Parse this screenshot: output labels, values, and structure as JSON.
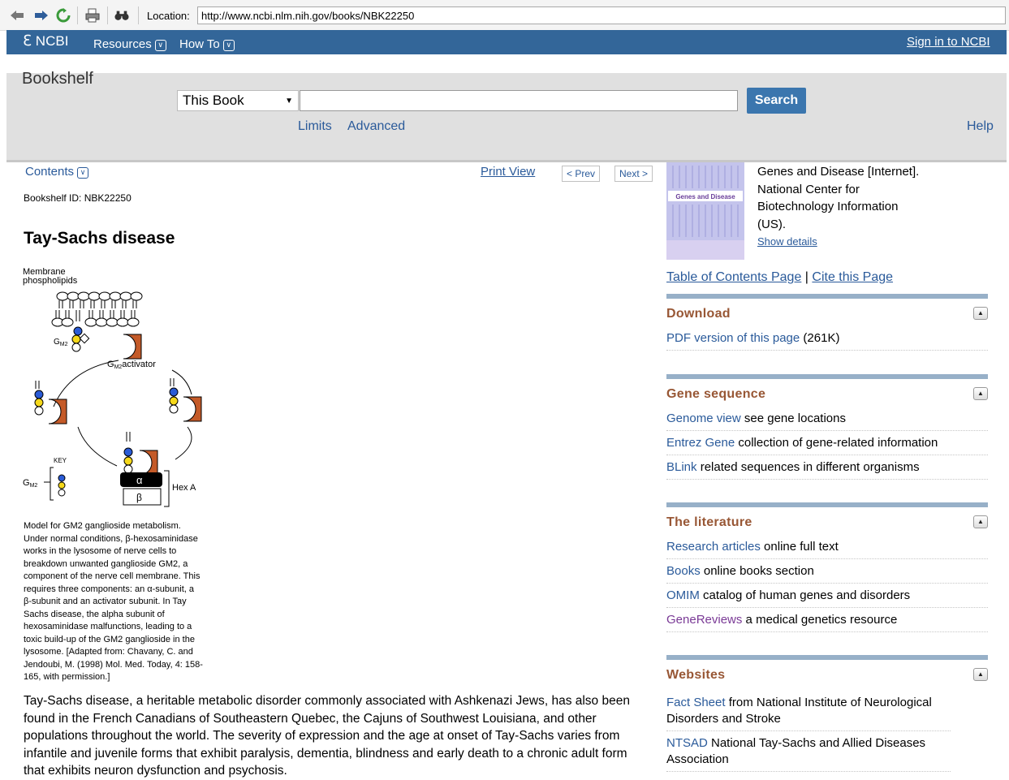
{
  "browser": {
    "location_label": "Location:",
    "url": "http://www.ncbi.nlm.nih.gov/books/NBK22250",
    "icons": [
      "back-icon",
      "forward-icon",
      "reload-icon",
      "print-icon",
      "find-icon"
    ]
  },
  "ncbi_bar": {
    "logo": "NCBI",
    "resources": "Resources",
    "howto": "How To",
    "signin": "Sign in to NCBI"
  },
  "search": {
    "title": "Bookshelf",
    "scope": "This Book",
    "term": "",
    "button": "Search",
    "limits": "Limits",
    "advanced": "Advanced",
    "help": "Help"
  },
  "article": {
    "contents": "Contents",
    "print_view": "Print View",
    "prev": "< Prev",
    "next": "Next >",
    "bookshelf_id": "Bookshelf ID: NBK22250",
    "title": "Tay-Sachs disease",
    "figure": {
      "membrane": "Membrane",
      "phospholipids": "phospholipids",
      "activator": "activator",
      "key": "KEY",
      "hexa": "Hex A",
      "alpha": "α",
      "beta": "β"
    },
    "caption_lines": [
      "Model for GM2 ganglioside metabolism.",
      "Under normal conditions, β-hexosaminidase",
      "works in the lysosome of nerve cells to",
      "breakdown unwanted ganglioside GM2, a",
      "component of the nerve cell membrane. This",
      "requires three components: an α-subunit, a",
      "β-subunit and an activator subunit. In Tay",
      "Sachs disease, the alpha subunit of",
      "hexosaminidase malfunctions, leading to a",
      "toxic build-up of the GM2 ganglioside in the",
      "lysosome. [Adapted from: Chavany, C. and",
      "Jendoubi, M. (1998) Mol. Med. Today, 4: 158-",
      "165, with permission.]"
    ],
    "body_lines": [
      "Tay-Sachs disease, a heritable metabolic disorder commonly associated with Ashkenazi Jews, has also been",
      "found in the French Canadians of Southeastern Quebec, the Cajuns of Southwest Louisiana, and other",
      "populations throughout the world. The severity of expression and the age at onset of Tay-Sachs varies from",
      "infantile and juvenile forms that exhibit paralysis, dementia, blindness and early death to a chronic adult form",
      "that exhibits neuron dysfunction and psychosis."
    ]
  },
  "sidebar": {
    "cover_title": "Genes and Disease",
    "book_lines": [
      "Genes and Disease [Internet].",
      "National Center for",
      "Biotechnology Information",
      "(US)."
    ],
    "show_details": "Show details",
    "toc_page": "Table of Contents Page",
    "divider": "|",
    "cite": "Cite this Page",
    "sections": [
      {
        "title": "Download",
        "rows": [
          {
            "link": "PDF version of this page",
            "text": " (261K)"
          }
        ]
      },
      {
        "title": "Gene sequence",
        "rows": [
          {
            "link": "Genome view",
            "text": " see gene locations"
          },
          {
            "link": "Entrez Gene",
            "text": " collection of gene-related information"
          },
          {
            "link": "BLink",
            "text": " related sequences in different organisms"
          }
        ]
      },
      {
        "title": "The literature",
        "rows": [
          {
            "link": "Research articles",
            "text": " online full text"
          },
          {
            "link": "Books",
            "text": " online books section"
          },
          {
            "link": "OMIM",
            "text": " catalog of human genes and disorders"
          },
          {
            "link": "GeneReviews",
            "text": " a medical genetics resource"
          }
        ]
      },
      {
        "title": "Websites",
        "rows": [
          {
            "link": "Fact Sheet",
            "text": " from National Institute of Neurological Disorders and Stroke"
          },
          {
            "link": "NTSAD",
            "text": " National Tay-Sachs and Allied Diseases Association"
          }
        ]
      }
    ]
  }
}
